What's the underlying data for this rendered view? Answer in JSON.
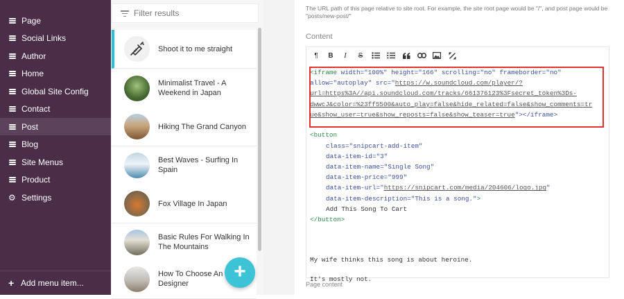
{
  "sidebar": {
    "items": [
      {
        "label": "Page",
        "icon": "menu-icon"
      },
      {
        "label": "Social Links",
        "icon": "menu-icon"
      },
      {
        "label": "Author",
        "icon": "menu-icon"
      },
      {
        "label": "Home",
        "icon": "menu-icon"
      },
      {
        "label": "Global Site Config",
        "icon": "menu-icon"
      },
      {
        "label": "Contact",
        "icon": "menu-icon"
      },
      {
        "label": "Post",
        "icon": "menu-icon",
        "active": true
      },
      {
        "label": "Blog",
        "icon": "menu-icon"
      },
      {
        "label": "Site Menus",
        "icon": "menu-icon"
      },
      {
        "label": "Product",
        "icon": "menu-icon"
      },
      {
        "label": "Settings",
        "icon": "gear-icon"
      }
    ],
    "add_menu_item": "Add menu item...",
    "bg_color": "#4a2e48"
  },
  "entries": {
    "filter_placeholder": "Filter results",
    "items": [
      {
        "title": "Shoot it to me straight",
        "active": true
      },
      {
        "title": "Minimalist Travel - A Weekend in Japan"
      },
      {
        "title": "Hiking The Grand Canyon"
      },
      {
        "title": "Best Waves - Surfing In Spain"
      },
      {
        "title": "Fox Village In Japan"
      },
      {
        "title": "Basic Rules For Walking In The Mountains"
      },
      {
        "title": "How To Choose An Interior Designer"
      }
    ],
    "fab_label": "+",
    "accent": "#3cc3d6"
  },
  "editor": {
    "help_text": "The URL path of this page relative to site root. For example, the site root page would be \"/\", and post page would be \"posts/new-post/\"",
    "content_label": "Content",
    "toolbar": {
      "paragraph": "¶",
      "bold": "B",
      "italic": "I",
      "strike": "S"
    },
    "iframe_lines": [
      [
        "<iframe",
        " width=",
        "\"100%\"",
        " height=",
        "\"166\"",
        " scrolling=",
        "\"no\"",
        " frameborder=",
        "\"no\""
      ],
      [
        "allow=",
        "\"autoplay\"",
        " src=",
        "\"",
        "https://w.soundcloud.com/player/?"
      ],
      [
        "url=https%3A//api.soundcloud.com/tracks/661376123%3Fsecret_token%3Ds-"
      ],
      [
        "dwwcJ&color=%23ff5500&auto_play=false&hide_related=false&show_comments=tr"
      ],
      [
        "ue&show_user=true&show_reposts=false&show_teaser=true",
        "\"",
        "></iframe>"
      ]
    ],
    "button_lines": [
      "<button",
      [
        "class=",
        "\"snipcart-add-item\""
      ],
      [
        "data-item-id=",
        "\"3\""
      ],
      [
        "data-item-name=",
        "\"Single Song\""
      ],
      [
        "data-item-price=",
        "\"999\""
      ],
      [
        "data-item-url=",
        "\"",
        "https://snipcart.com/media/204606/logo.jpg",
        "\""
      ],
      [
        "data-item-description=",
        "\"This is a song.\"",
        ">"
      ],
      "Add This Song To Cart",
      "</button>"
    ],
    "paragraph_1": "My wife thinks this song is about heroine.",
    "paragraph_2": "It's mostly not.",
    "page_content_label": "Page content",
    "highlight_color": "#e1322b"
  }
}
